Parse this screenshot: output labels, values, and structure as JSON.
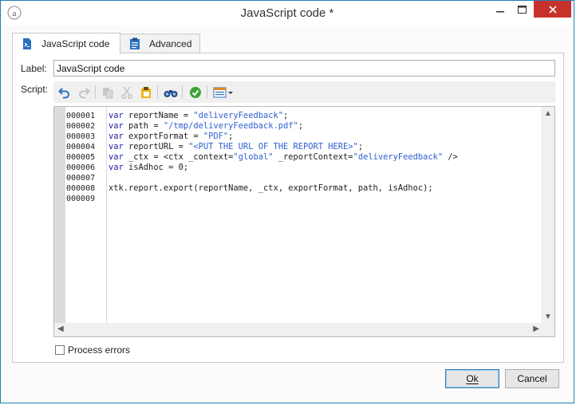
{
  "window": {
    "title": "JavaScript code *",
    "minimize": "−",
    "maximize": "☐",
    "close": "✕"
  },
  "tabs": [
    {
      "label": "JavaScript code",
      "icon": "script-file-icon",
      "active": true
    },
    {
      "label": "Advanced",
      "icon": "clipboard-list-icon",
      "active": false
    }
  ],
  "form": {
    "label_caption": "Label:",
    "label_value": "JavaScript code",
    "script_caption": "Script:"
  },
  "toolbar": {
    "buttons": [
      "undo",
      "redo",
      "copy",
      "cut",
      "paste",
      "find",
      "check-syntax",
      "insert-dropdown"
    ]
  },
  "editor": {
    "line_numbers": [
      "000001",
      "000002",
      "000003",
      "000004",
      "000005",
      "000006",
      "000007",
      "000008",
      "000009"
    ],
    "lines": [
      "var reportName = \"deliveryFeedback\";",
      "var path = \"/tmp/deliveryFeedback.pdf\";",
      "var exportFormat = \"PDF\";",
      "var reportURL = \"<PUT THE URL OF THE REPORT HERE>\";",
      "var _ctx = <ctx _context=\"global\" _reportContext=\"deliveryFeedback\" />",
      "var isAdhoc = 0;",
      "",
      "xtk.report.export(reportName, _ctx, exportFormat, path, isAdhoc);",
      ""
    ]
  },
  "options": {
    "process_errors": "Process errors"
  },
  "buttons": {
    "ok": "Ok",
    "cancel": "Cancel"
  },
  "colors": {
    "close_button": "#c7312b",
    "keyword": "#1a1aa6",
    "string": "#2e5fd0",
    "accent_border": "#1f7fb8"
  }
}
